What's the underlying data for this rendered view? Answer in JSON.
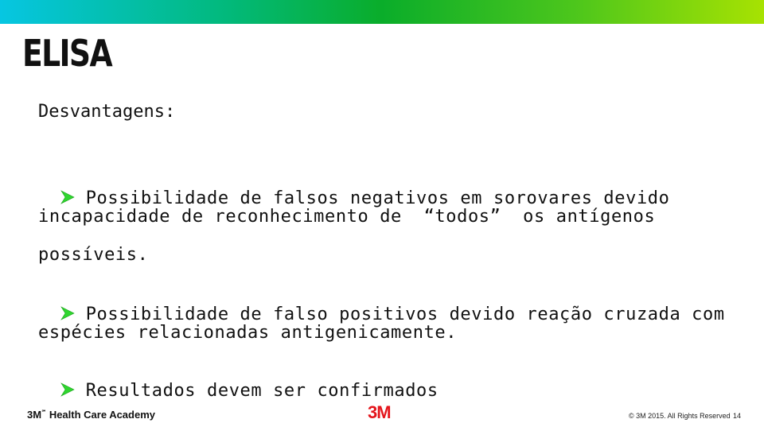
{
  "slide": {
    "title": "ELISA",
    "subtitle": "Desvantagens:",
    "accent_color": "#2fd62f",
    "lines": [
      "Possibilidade de falsos negativos em sorovares devido",
      "incapacidade de reconhecimento de  “todos”  os antígenos",
      "possíveis.",
      "Possibilidade de falso positivos devido reação cruzada com",
      "espécies relacionadas antigenicamente.",
      "Resultados devem ser confirmados"
    ]
  },
  "footer": {
    "brand": "3M",
    "brand_tm": "℠",
    "brand_rest": "Health Care Academy",
    "logo": "3M",
    "copyright": "© 3M 2015. All Rights Reserved",
    "page_number": "14"
  }
}
